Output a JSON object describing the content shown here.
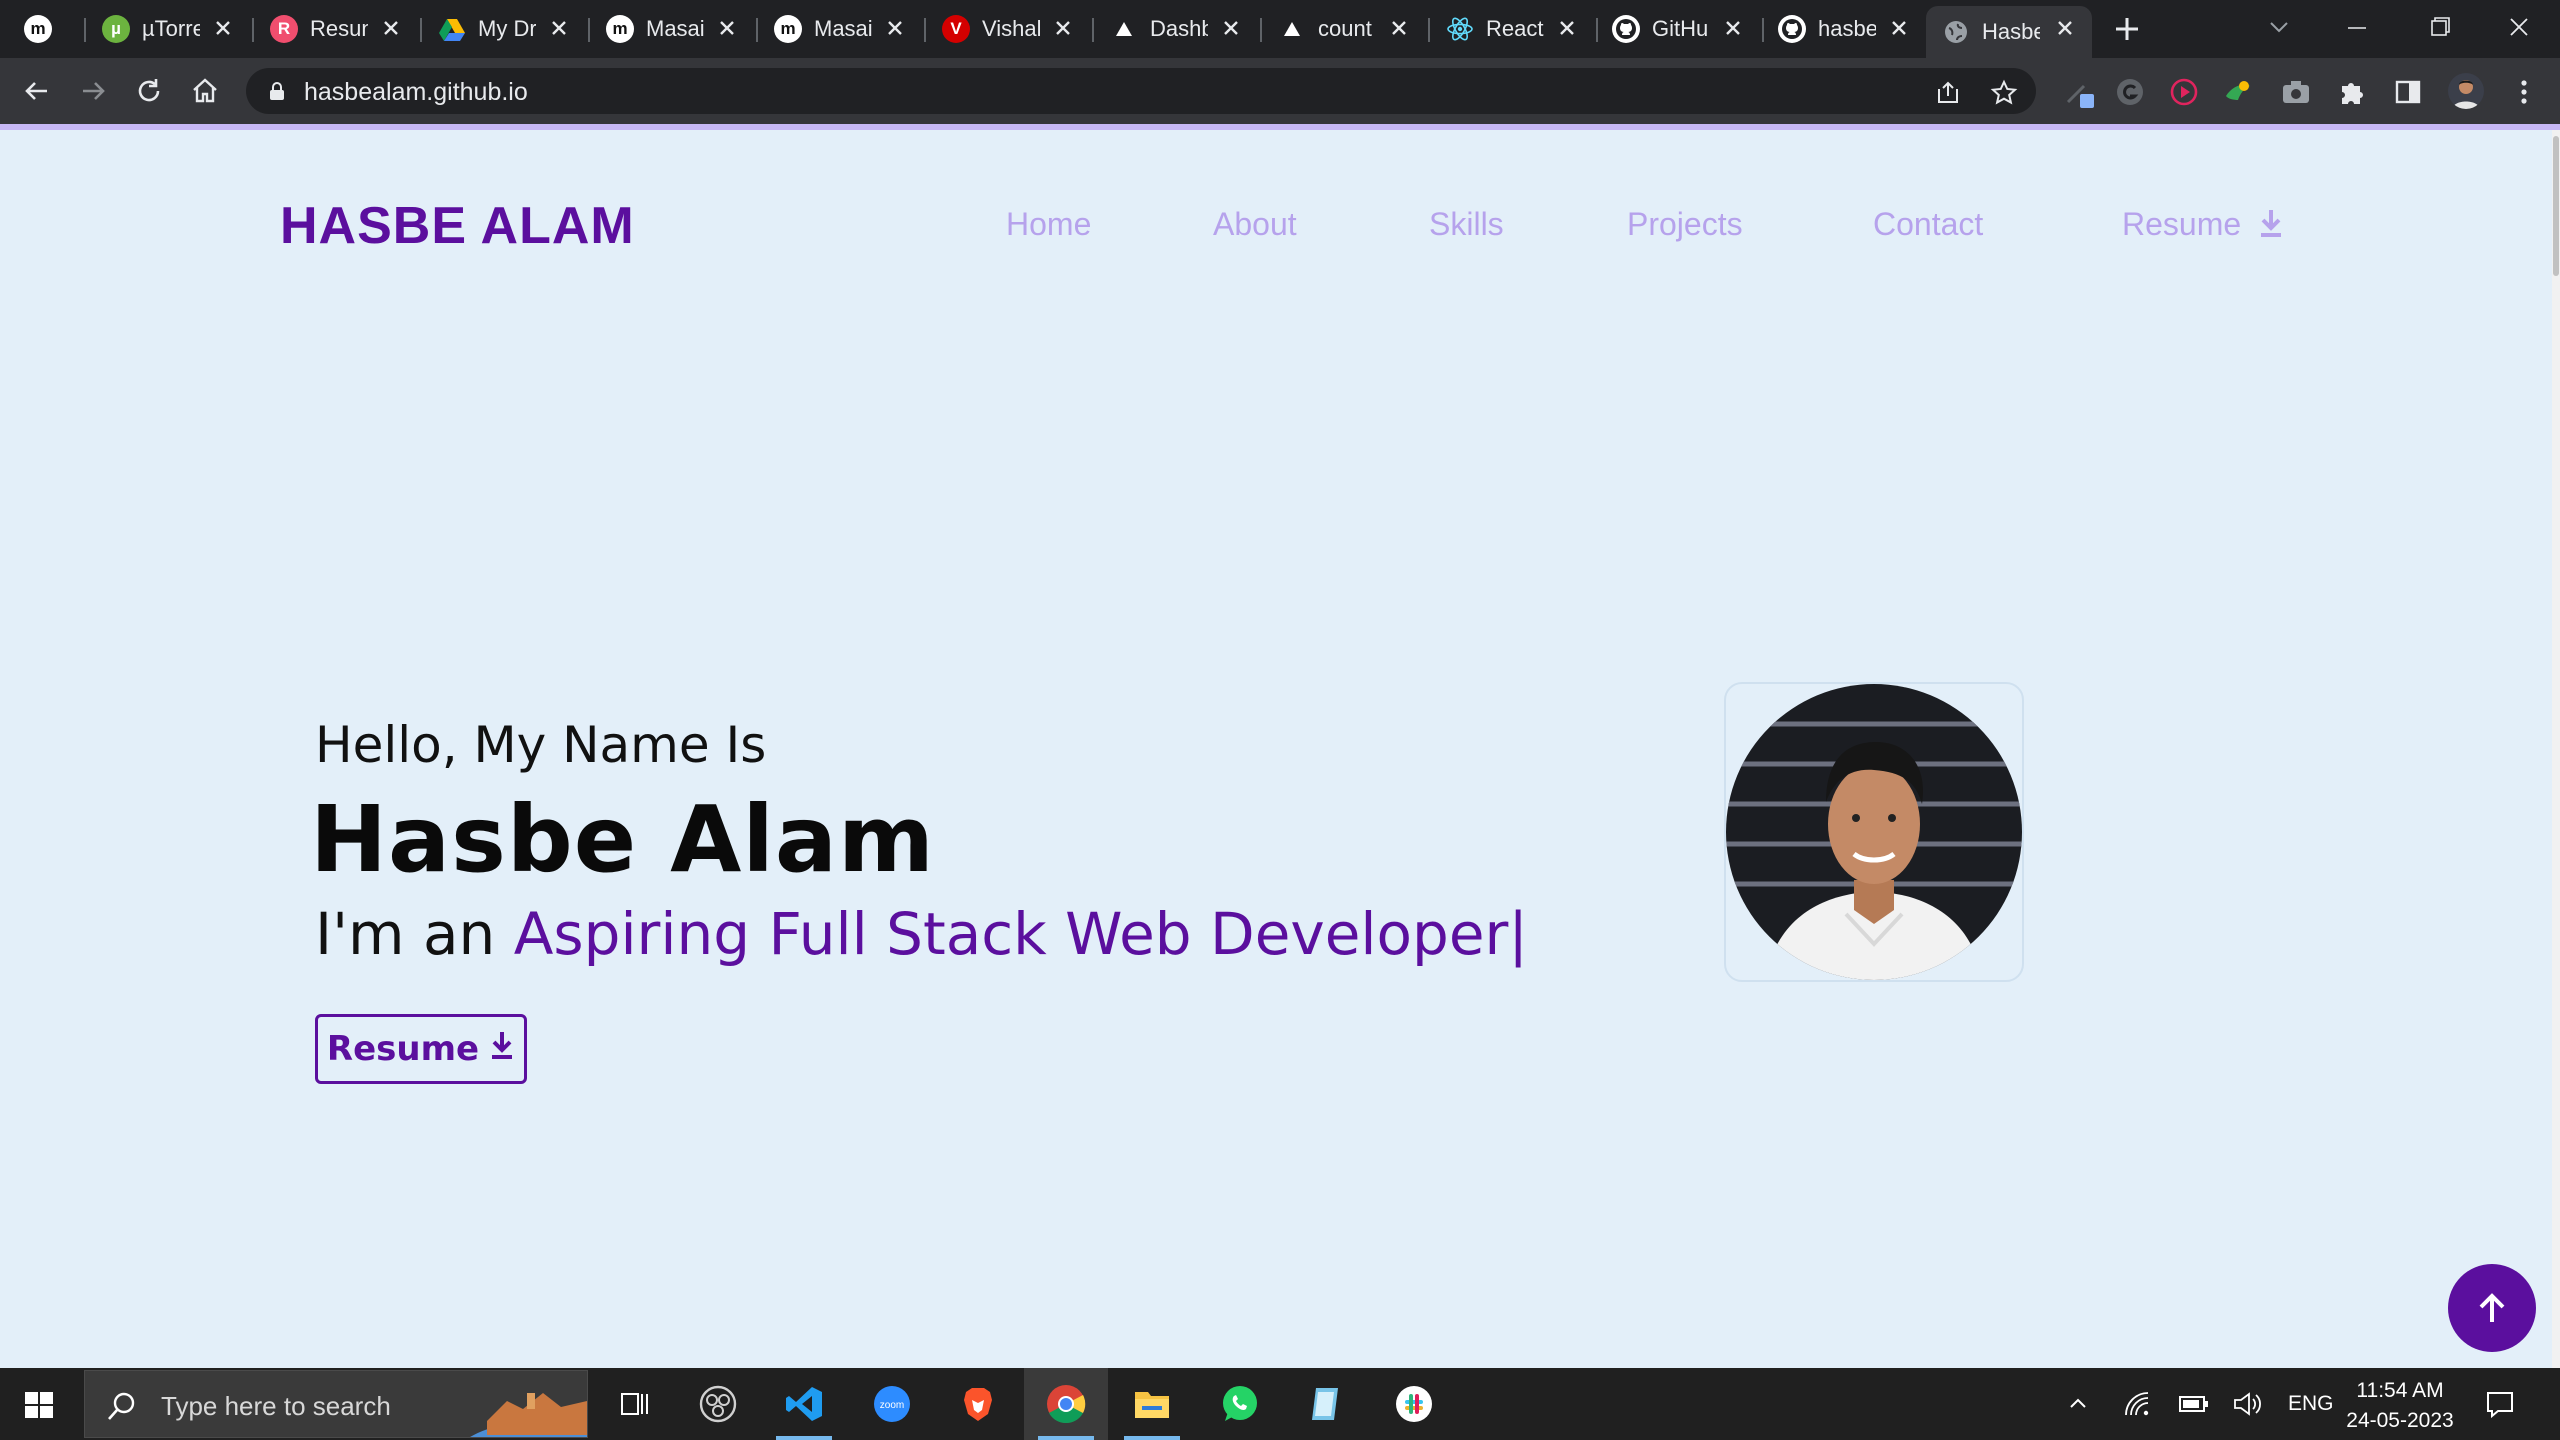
{
  "browser": {
    "tabs": [
      {
        "title": "",
        "icon": "masai-icon"
      },
      {
        "title": "µTorre",
        "icon": "utorrent-icon"
      },
      {
        "title": "Resun",
        "icon": "resume-site-icon"
      },
      {
        "title": "My Dr",
        "icon": "google-drive-icon"
      },
      {
        "title": "Masai",
        "icon": "masai-icon"
      },
      {
        "title": "Masai",
        "icon": "masai-icon"
      },
      {
        "title": "Vishal",
        "icon": "vercel-v-icon"
      },
      {
        "title": "Dashb",
        "icon": "triangle-icon"
      },
      {
        "title": "count",
        "icon": "triangle-icon"
      },
      {
        "title": "React",
        "icon": "react-icon"
      },
      {
        "title": "GitHu",
        "icon": "github-icon"
      },
      {
        "title": "hasbe",
        "icon": "github-icon"
      },
      {
        "title": "Hasbe",
        "icon": "globe-icon",
        "active": true
      }
    ],
    "url": "hasbealam.github.io"
  },
  "site": {
    "logo": "HASBE ALAM",
    "nav": [
      "Home",
      "About",
      "Skills",
      "Projects",
      "Contact",
      "Resume"
    ],
    "hero": {
      "greeting": "Hello, My Name Is",
      "name": "Hasbe Alam",
      "role_prefix": "I'm an ",
      "role_typed": "Aspiring Full Stack Web Developer",
      "cursor": "|",
      "resume_button": "Resume"
    },
    "colors": {
      "accent": "#5b0f9e",
      "nav_link": "#b6a2ec",
      "background": "#e3eff9"
    }
  },
  "taskbar": {
    "search_placeholder": "Type here to search",
    "language": "ENG",
    "time": "11:54 AM",
    "date": "24-05-2023"
  }
}
